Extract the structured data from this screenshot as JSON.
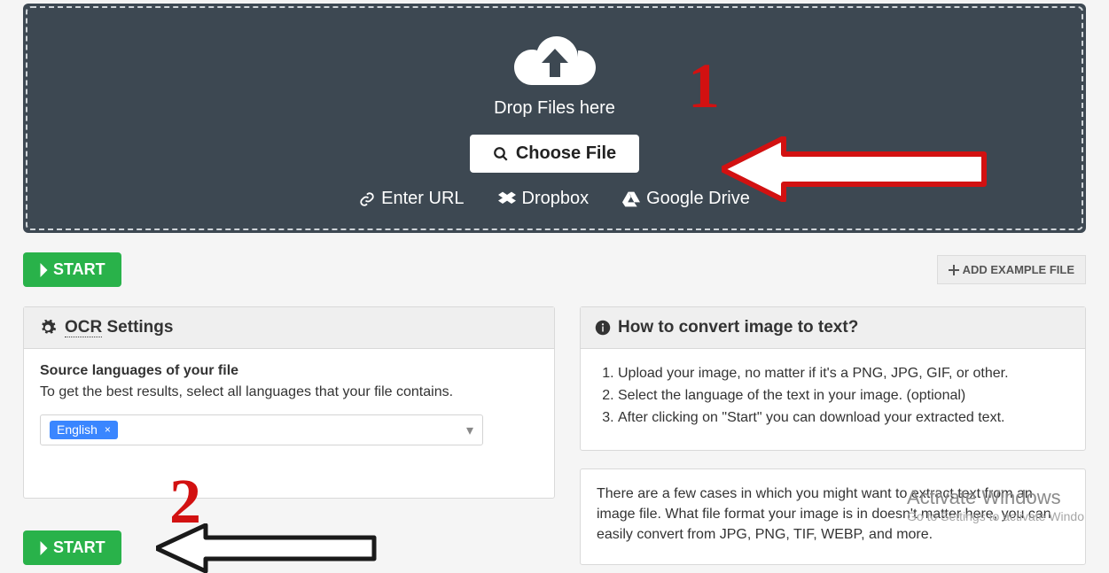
{
  "dropzone": {
    "drop_text": "Drop Files here",
    "choose_label": "Choose File",
    "sources": {
      "url": "Enter URL",
      "dropbox": "Dropbox",
      "gdrive": "Google Drive"
    }
  },
  "start_label": "START",
  "add_example_label": "ADD EXAMPLE FILE",
  "ocr_panel": {
    "title_prefix": "OCR",
    "title_suffix": " Settings",
    "src_label": "Source languages of your file",
    "src_help": "To get the best results, select all languages that your file contains.",
    "selected_lang": "English"
  },
  "howto": {
    "title": "How to convert image to text?",
    "steps": [
      "Upload your image, no matter if it's a PNG, JPG, GIF, or other.",
      "Select the language of the text in your image. (optional)",
      "After clicking on \"Start\" you can download your extracted text."
    ]
  },
  "blurb": "There are a few cases in which you might want to extract text from an image file. What file format your image is in doesn't matter here, you can easily convert from JPG, PNG, TIF, WEBP, and more.",
  "annotations": {
    "one": "1",
    "two": "2"
  },
  "watermark": {
    "line1": "Activate Windows",
    "line2": "Go to Settings to activate Windo"
  }
}
